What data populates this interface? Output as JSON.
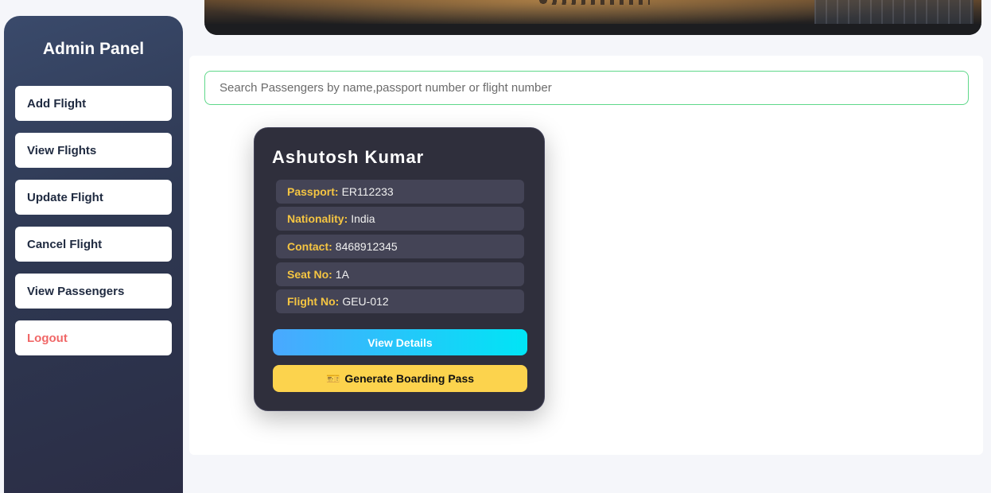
{
  "sidebar": {
    "title": "Admin Panel",
    "items": [
      {
        "label": "Add Flight"
      },
      {
        "label": "View Flights"
      },
      {
        "label": "Update Flight"
      },
      {
        "label": "Cancel Flight"
      },
      {
        "label": "View Passengers"
      },
      {
        "label": "Logout"
      }
    ]
  },
  "search": {
    "placeholder": "Search Passengers by name,passport number or flight number",
    "value": ""
  },
  "passenger_card": {
    "name": "Ashutosh Kumar",
    "fields": [
      {
        "key": "Passport:",
        "value": "ER112233"
      },
      {
        "key": "Nationality:",
        "value": "India"
      },
      {
        "key": "Contact:",
        "value": "8468912345"
      },
      {
        "key": "Seat No:",
        "value": "1A"
      },
      {
        "key": "Flight No:",
        "value": "GEU-012"
      }
    ],
    "view_details_label": "View Details",
    "boarding_pass_icon": "ticket-icon",
    "boarding_pass_glyph": "🎫",
    "boarding_pass_label": "Generate Boarding Pass"
  },
  "colors": {
    "accent_green": "#5fd88a",
    "label_yellow": "#f5c542",
    "logout_red": "#f06767",
    "card_bg": "#2f2f3c"
  }
}
